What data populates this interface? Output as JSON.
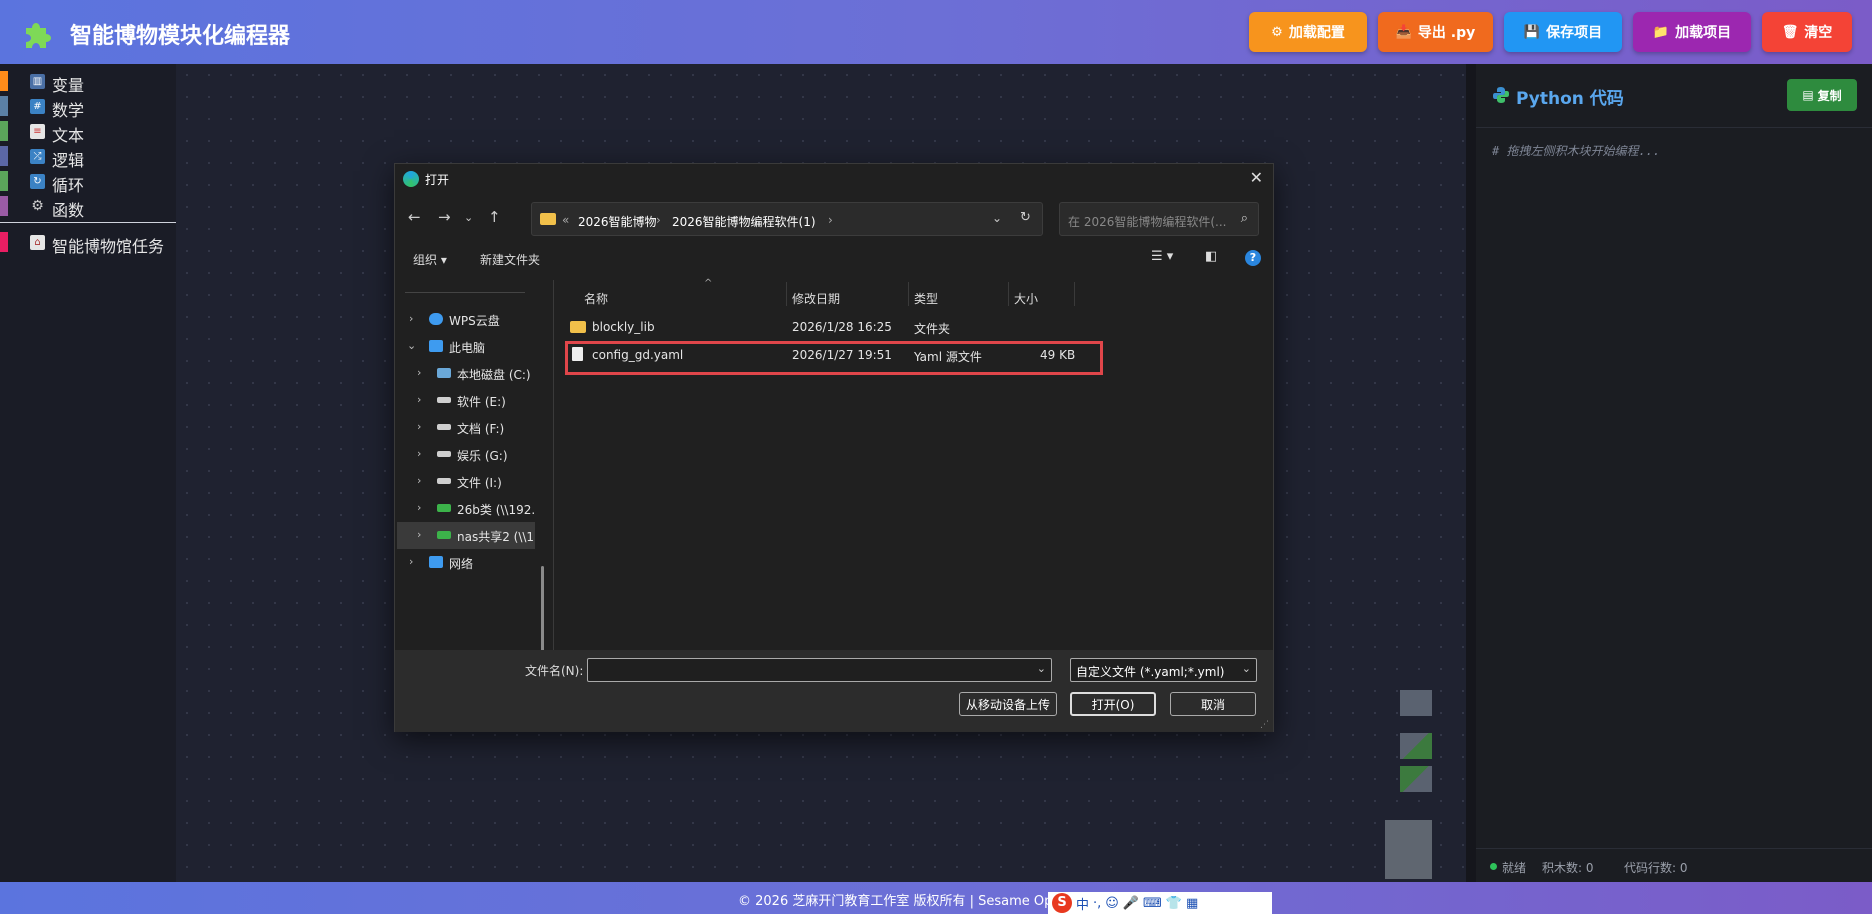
{
  "app": {
    "title": "智能博物模块化编程器"
  },
  "header_buttons": [
    {
      "label": "加载配置",
      "icon": "⚙",
      "color": "#f7941d"
    },
    {
      "label": "导出 .py",
      "icon": "📥",
      "color": "#f06a1e"
    },
    {
      "label": "保存项目",
      "icon": "💾",
      "color": "#2196f3"
    },
    {
      "label": "加载项目",
      "icon": "📁",
      "color": "#9c27b0"
    },
    {
      "label": "清空",
      "icon": "🗑",
      "color": "#f44336"
    }
  ],
  "categories": [
    {
      "label": "变量",
      "color": "#ff8c1a",
      "icon": "📊"
    },
    {
      "label": "数学",
      "color": "#5b80a5",
      "icon": "🔢"
    },
    {
      "label": "文本",
      "color": "#5ba55b",
      "icon": "📄"
    },
    {
      "label": "逻辑",
      "color": "#5b67a5",
      "icon": "🔀"
    },
    {
      "label": "循环",
      "color": "#5ba55b",
      "icon": "🔁"
    },
    {
      "label": "函数",
      "color": "#9a5ba5",
      "icon": "⚙"
    },
    {
      "label": "智能博物馆任务",
      "color": "#e91e63",
      "icon": "🏛"
    }
  ],
  "code_panel": {
    "title": "Python 代码",
    "copy_label": "复制",
    "comment": "# 拖拽左侧积木块开始编程...",
    "status": {
      "ready": "就绪",
      "blocks": "积木数: 0",
      "lines": "代码行数: 0"
    }
  },
  "footer": {
    "text": "© 2026 芝麻开门教育工作室 版权所有 | Sesame Open Ec"
  },
  "ime": {
    "lang": "中",
    "punct": "·,"
  },
  "dialog": {
    "title": "打开",
    "path": [
      "2026智能博物",
      "2026智能博物编程软件(1)"
    ],
    "path_prefix": "«",
    "search_placeholder": "在 2026智能博物编程软件(...",
    "toolbar": {
      "organize": "组织 ▾",
      "new_folder": "新建文件夹"
    },
    "nav": [
      {
        "label": "WPS云盘",
        "expanded": false,
        "indent": 0,
        "color": "#3e9bf0"
      },
      {
        "label": "此电脑",
        "expanded": true,
        "indent": 0,
        "color": "#3e9bf0"
      },
      {
        "label": "本地磁盘 (C:)",
        "indent": 1,
        "color": "#6aa8d8"
      },
      {
        "label": "软件 (E:)",
        "indent": 1,
        "color": "#cfcfcf"
      },
      {
        "label": "文档 (F:)",
        "indent": 1,
        "color": "#cfcfcf"
      },
      {
        "label": "娱乐 (G:)",
        "indent": 1,
        "color": "#cfcfcf"
      },
      {
        "label": "文件 (I:)",
        "indent": 1,
        "color": "#cfcfcf"
      },
      {
        "label": "26b类 (\\\\192.",
        "indent": 1,
        "color": "#3cb34a"
      },
      {
        "label": "nas共享2 (\\\\1",
        "indent": 1,
        "color": "#3cb34a",
        "selected": true
      },
      {
        "label": "网络",
        "expanded": false,
        "indent": 0,
        "color": "#3e9bf0"
      }
    ],
    "columns": [
      "名称",
      "修改日期",
      "类型",
      "大小"
    ],
    "files": [
      {
        "name": "blockly_lib",
        "date": "2026/1/28 16:25",
        "type": "文件夹",
        "size": "",
        "kind": "folder"
      },
      {
        "name": "config_gd.yaml",
        "date": "2026/1/27 19:51",
        "type": "Yaml 源文件",
        "size": "49 KB",
        "kind": "file"
      }
    ],
    "filename_label": "文件名(N):",
    "filename_value": "",
    "filetype": "自定义文件 (*.yaml;*.yml)",
    "buttons": {
      "upload": "从移动设备上传",
      "open": "打开(O)",
      "cancel": "取消"
    }
  }
}
